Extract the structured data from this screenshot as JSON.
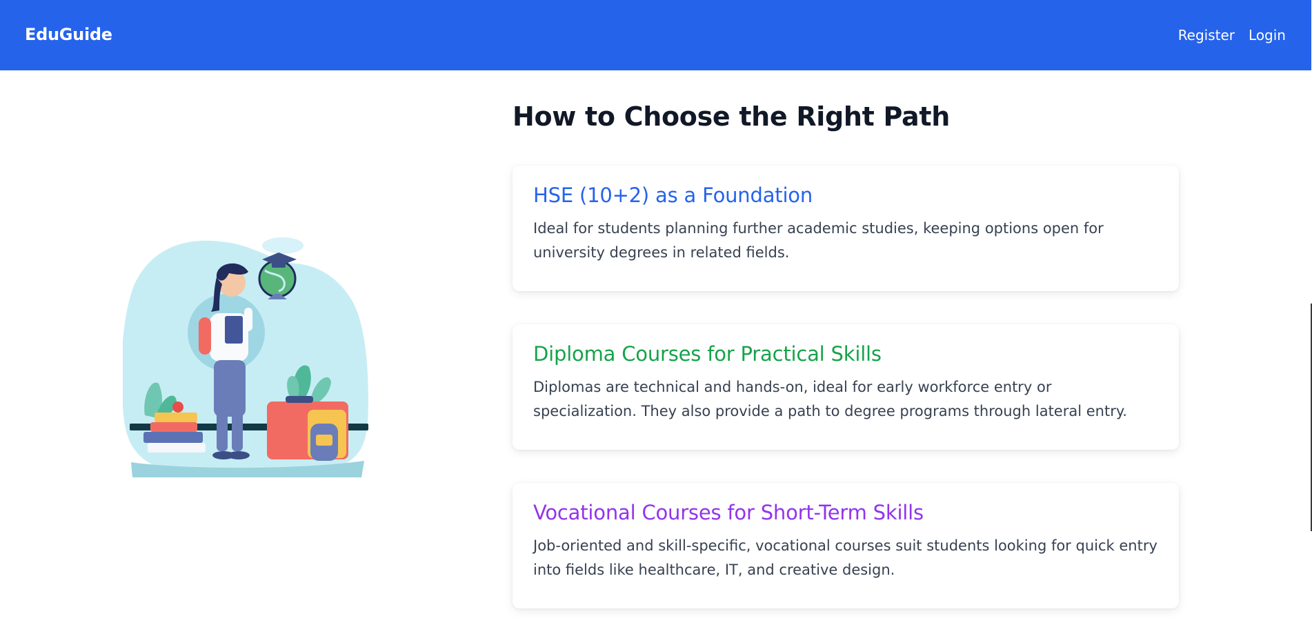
{
  "header": {
    "brand": "EduGuide",
    "links": [
      "Register",
      "Login"
    ]
  },
  "main": {
    "title": "How to Choose the Right Path",
    "cards": [
      {
        "title": "HSE (10+2) as a Foundation",
        "body": "Ideal for students planning further academic studies, keeping options open for university degrees in related fields.",
        "color": "#2563eb"
      },
      {
        "title": "Diploma Courses for Practical Skills",
        "body": "Diplomas are technical and hands-on, ideal for early workforce entry or specialization. They also provide a path to degree programs through lateral entry.",
        "color": "#16a34a"
      },
      {
        "title": "Vocational Courses for Short-Term Skills",
        "body": "Job-oriented and skill-specific, vocational courses suit students looking for quick entry into fields like healthcare, IT, and creative design.",
        "color": "#9333ea"
      }
    ]
  },
  "colors": {
    "navbar": "#2563eb",
    "page_background": "#ffffff",
    "heading": "#111827",
    "body_text": "#374151"
  },
  "illustration": {
    "icon": "student-with-globe-illustration"
  }
}
